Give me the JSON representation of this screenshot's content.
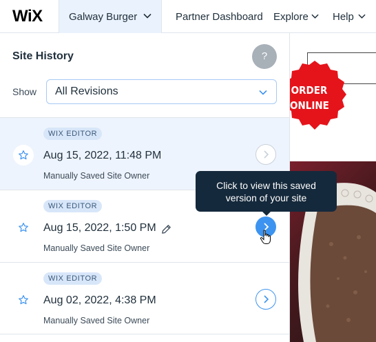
{
  "topbar": {
    "logo": "WiX",
    "site_name": "Galway Burger",
    "nav": {
      "partner": "Partner Dashboard",
      "explore": "Explore",
      "help": "Help"
    }
  },
  "panel": {
    "title": "Site History",
    "help_glyph": "?",
    "show_label": "Show",
    "filter_value": "All Revisions"
  },
  "revisions": [
    {
      "badge": "WIX EDITOR",
      "date": "Aug 15, 2022, 11:48 PM",
      "subtitle": "Manually Saved Site Owner"
    },
    {
      "badge": "WIX EDITOR",
      "date": "Aug 15, 2022, 1:50 PM",
      "subtitle": "Manually Saved Site Owner"
    },
    {
      "badge": "WIX EDITOR",
      "date": "Aug 02, 2022, 4:38 PM",
      "subtitle": "Manually Saved Site Owner"
    }
  ],
  "tooltip": {
    "line1": "Click to view this saved",
    "line2": "version of your site"
  },
  "preview": {
    "seal_line1": "ORDER",
    "seal_line2": "ONLINE"
  },
  "colors": {
    "accent": "#3d93f0",
    "selected_row": "#eef4fd",
    "tooltip_bg": "#15293c",
    "seal_red": "#e5141b"
  },
  "icons": [
    "chevron-down-icon",
    "help-icon",
    "star-icon",
    "chevron-right-icon",
    "pencil-icon",
    "hand-cursor-icon"
  ]
}
